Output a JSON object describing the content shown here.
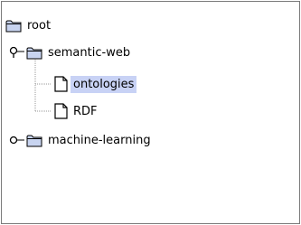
{
  "tree": {
    "root": {
      "label": "root",
      "icon": "folder-icon",
      "expanded": true
    },
    "nodes": [
      {
        "label": "semantic-web",
        "icon": "folder-icon",
        "expanded": true,
        "children": [
          {
            "label": "ontologies",
            "icon": "document-icon",
            "selected": true
          },
          {
            "label": "RDF",
            "icon": "document-icon",
            "selected": false
          }
        ]
      },
      {
        "label": "machine-learning",
        "icon": "folder-icon",
        "expanded": false
      }
    ],
    "colors": {
      "selection": "#c8d2f5",
      "folder_fill": "#c8d4f0",
      "folder_stroke": "#000000",
      "connector": "#9a9a9a"
    }
  }
}
